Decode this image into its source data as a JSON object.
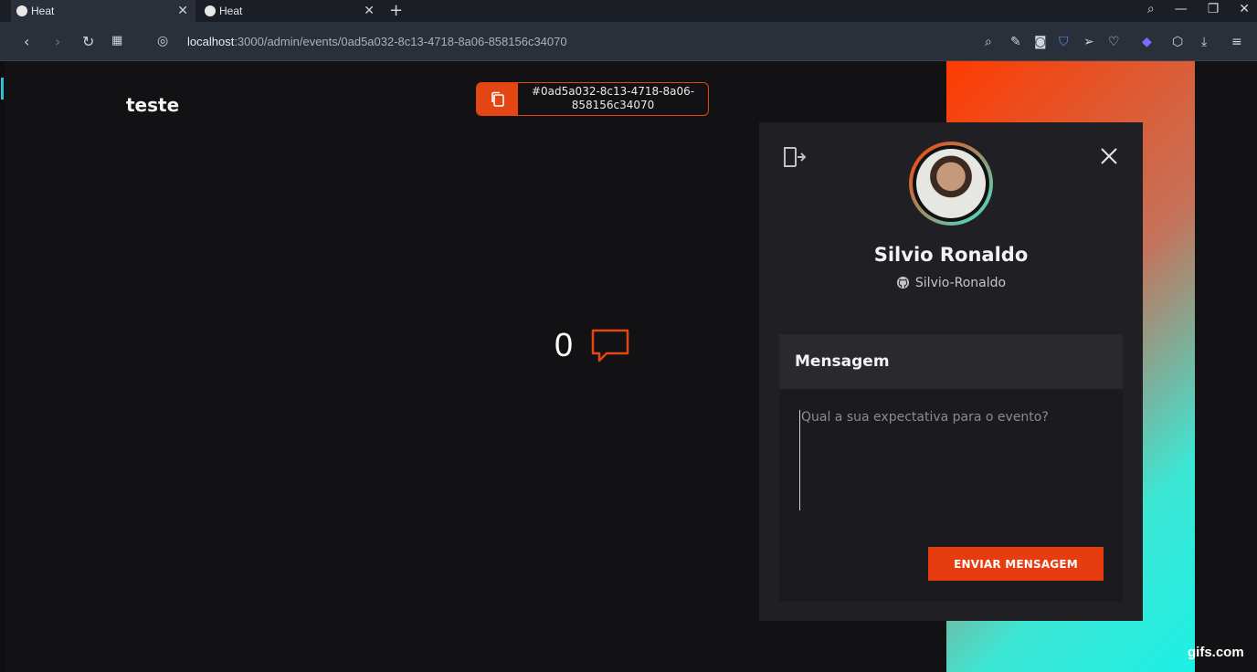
{
  "browser": {
    "tabs": [
      {
        "label": "Heat",
        "active": true
      },
      {
        "label": "Heat",
        "active": false
      }
    ],
    "url_host": "localhost",
    "url_path": ":3000/admin/events/0ad5a032-8c13-4718-8a06-858156c34070"
  },
  "event": {
    "title": "teste",
    "id_line1": "#0ad5a032-8c13-4718-8a06-",
    "id_line2": "858156c34070",
    "message_count": "0"
  },
  "user": {
    "name": "Silvio Ronaldo",
    "github": "Silvio-Ronaldo"
  },
  "message_form": {
    "header": "Mensagem",
    "placeholder": "Qual a sua expectativa para o evento?",
    "submit_label": "ENVIAR MENSAGEM"
  },
  "watermark": "gifs.com",
  "colors": {
    "accent": "#e63c0f",
    "gradient_start": "#ff3b00",
    "gradient_end": "#1df0e6"
  }
}
